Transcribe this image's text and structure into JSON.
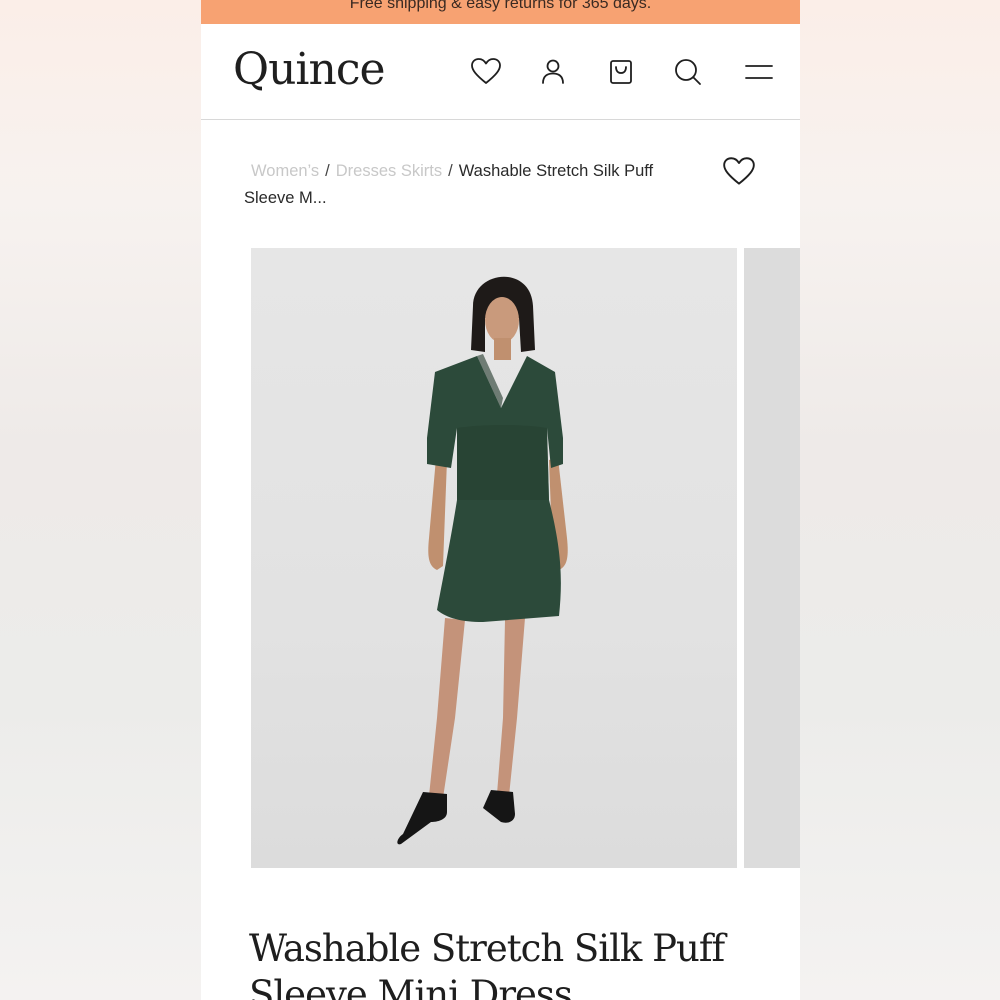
{
  "promo_banner": {
    "text": "Free shipping & easy returns for 365 days."
  },
  "header": {
    "logo": "Quince",
    "icons": [
      "heart-icon",
      "user-icon",
      "shopping-bag-icon",
      "search-icon",
      "menu-icon"
    ]
  },
  "breadcrumb": {
    "items": [
      {
        "label": "Women’s"
      },
      {
        "label": "Dresses Skirts"
      },
      {
        "label": "Washable Stretch Silk Puff Sleeve M..."
      }
    ],
    "separator": "/"
  },
  "product": {
    "title": "Washable Stretch Silk Puff Sleeve Mini Dress",
    "dress_color": "#2c4a3a"
  },
  "colors": {
    "promo_bg": "#f7a272",
    "text": "#1e1e1e",
    "faded": "#c8c8c8"
  }
}
